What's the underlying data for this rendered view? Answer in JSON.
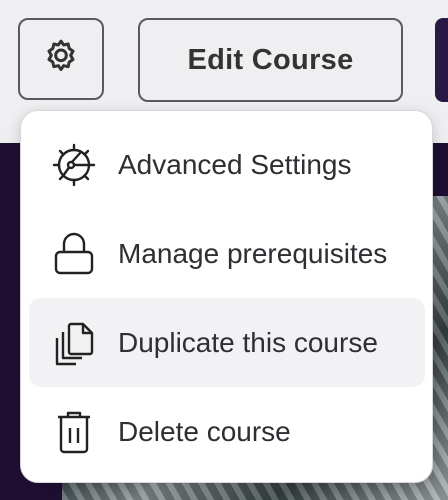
{
  "toolbar": {
    "settings_icon": "gear-icon",
    "edit_course_label": "Edit Course"
  },
  "menu": {
    "items": [
      {
        "label": "Advanced Settings",
        "icon": "advanced-settings-icon",
        "highlighted": false
      },
      {
        "label": "Manage prerequisites",
        "icon": "lock-icon",
        "highlighted": false
      },
      {
        "label": "Duplicate this course",
        "icon": "duplicate-icon",
        "highlighted": true
      },
      {
        "label": "Delete course",
        "icon": "trash-icon",
        "highlighted": false
      }
    ]
  },
  "colors": {
    "background": "#efeff1",
    "dark_band": "#1f0f33",
    "text": "#2e2e33",
    "highlight": "#f2f2f4"
  }
}
